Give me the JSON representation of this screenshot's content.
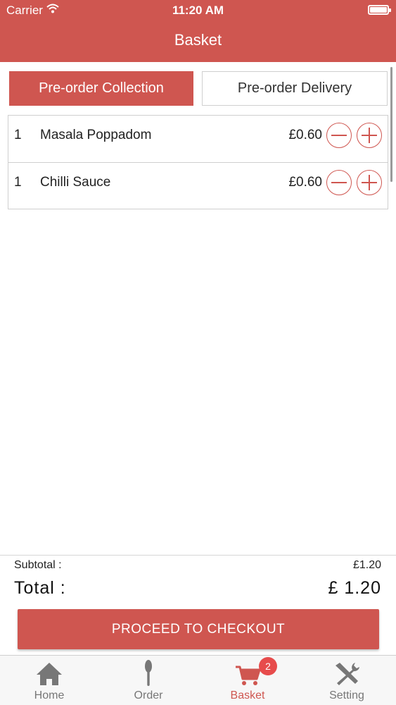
{
  "status_bar": {
    "carrier": "Carrier",
    "time": "11:20 AM"
  },
  "nav": {
    "title": "Basket"
  },
  "segments": {
    "collection": "Pre-order Collection",
    "delivery": "Pre-order Delivery",
    "selected": "collection"
  },
  "items": [
    {
      "qty": "1",
      "name": "Masala Poppadom",
      "price": "£0.60"
    },
    {
      "qty": "1",
      "name": "Chilli Sauce",
      "price": "£0.60"
    }
  ],
  "summary": {
    "subtotal_label": "Subtotal :",
    "subtotal_value": "£1.20",
    "total_label": "Total :",
    "total_value": "£ 1.20"
  },
  "checkout": {
    "label": "PROCEED TO CHECKOUT"
  },
  "tabs": [
    {
      "label": "Home",
      "icon": "home-icon"
    },
    {
      "label": "Order",
      "icon": "spoon-icon"
    },
    {
      "label": "Basket",
      "icon": "cart-icon",
      "active": true
    },
    {
      "label": "Setting",
      "icon": "tools-icon"
    }
  ],
  "basket_badge": "2",
  "colors": {
    "accent": "#cf5650",
    "badge": "#e74c4c",
    "tab_inactive": "#777777"
  }
}
